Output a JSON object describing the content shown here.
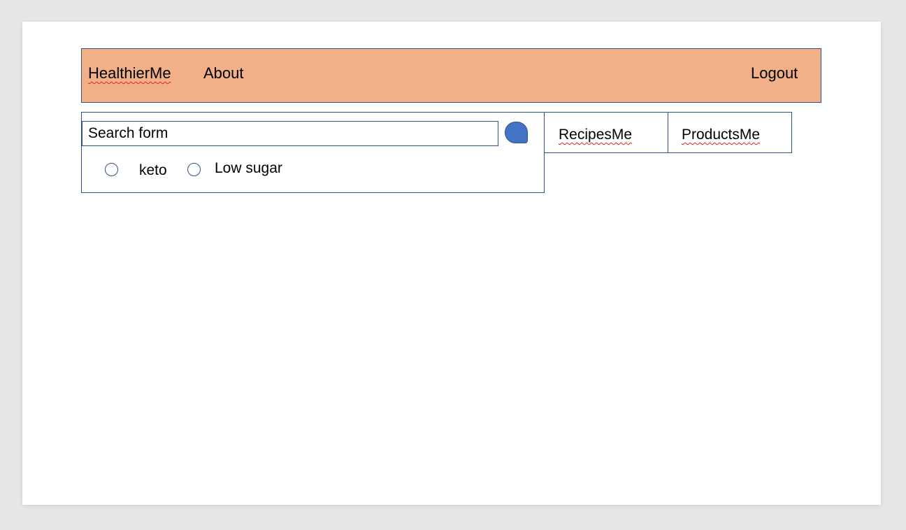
{
  "navbar": {
    "brand": "HealthierMe",
    "about": "About",
    "logout": "Logout",
    "background": "#f2b089"
  },
  "search": {
    "placeholder": "Search form",
    "button_icon": "search-icon",
    "filters": [
      {
        "label": "keto",
        "checked": false
      },
      {
        "label": "Low sugar",
        "checked": false
      }
    ]
  },
  "tabs": [
    {
      "label": "RecipesMe"
    },
    {
      "label": "ProductsMe"
    }
  ],
  "colors": {
    "border": "#2f528f",
    "accent": "#4472c4",
    "spellcheck": "#e0201c"
  }
}
